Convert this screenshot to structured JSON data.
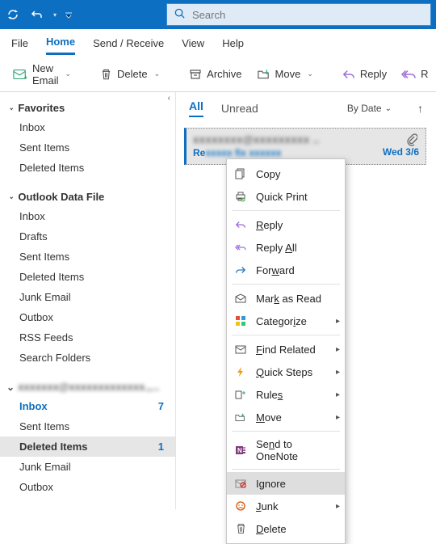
{
  "search": {
    "placeholder": "Search"
  },
  "menubar": [
    "File",
    "Home",
    "Send / Receive",
    "View",
    "Help"
  ],
  "ribbon": {
    "new_email": "New Email",
    "delete": "Delete",
    "archive": "Archive",
    "move": "Move",
    "reply": "Reply",
    "reply_all_short": "R"
  },
  "nav": {
    "favorites": {
      "title": "Favorites",
      "items": [
        "Inbox",
        "Sent Items",
        "Deleted Items"
      ]
    },
    "datafile": {
      "title": "Outlook Data File",
      "items": [
        "Inbox",
        "Drafts",
        "Sent Items",
        "Deleted Items",
        "Junk Email",
        "Outbox",
        "RSS Feeds",
        "Search Folders"
      ]
    },
    "account": {
      "title_obscured": "account",
      "items": [
        {
          "label": "Inbox",
          "badge": "7"
        },
        {
          "label": "Sent Items"
        },
        {
          "label": "Deleted Items",
          "badge": "1",
          "selected": true
        },
        {
          "label": "Junk Email"
        },
        {
          "label": "Outbox"
        }
      ]
    }
  },
  "list": {
    "tabs": {
      "all": "All",
      "unread": "Unread"
    },
    "sort": "By Date",
    "message": {
      "from_obscured": "sender",
      "subject_prefix": "Re",
      "date": "Wed 3/6"
    }
  },
  "ctx": {
    "copy": "Copy",
    "quick_print": "Quick Print",
    "reply": "Reply",
    "reply_all": "Reply All",
    "forward": "Forward",
    "mark_read": "Mark as Read",
    "categorize": "Categorize",
    "find_related": "Find Related",
    "quick_steps": "Quick Steps",
    "rules": "Rules",
    "move": "Move",
    "onenote": "Send to OneNote",
    "ignore": "Ignore",
    "junk": "Junk",
    "delete": "Delete"
  }
}
